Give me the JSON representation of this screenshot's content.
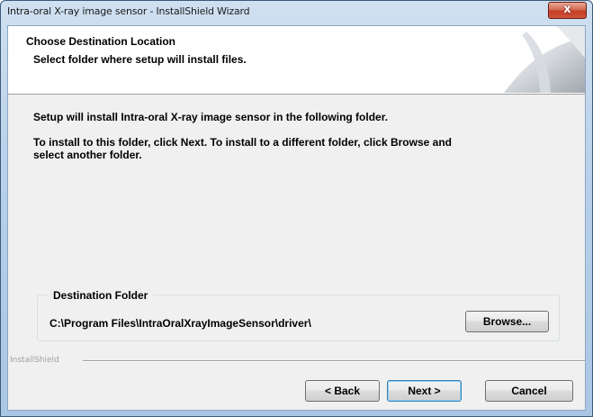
{
  "window": {
    "title": "Intra-oral X-ray image sensor - InstallShield Wizard",
    "close_glyph": "x"
  },
  "header": {
    "title": "Choose Destination Location",
    "subtitle": "Select folder where setup will install files."
  },
  "body": {
    "line1": "Setup will install Intra-oral X-ray image sensor in the following folder.",
    "line2a": "To install to this folder, click Next. To install to a different folder, click Browse and",
    "line2b": "select another folder."
  },
  "destination": {
    "group_label": "Destination Folder",
    "path": "C:\\Program Files\\IntraOralXrayImageSensor\\driver\\",
    "browse_label": "Browse..."
  },
  "footer": {
    "brand": "InstallShield",
    "back_label": "< Back",
    "next_label": "Next >",
    "cancel_label": "Cancel"
  }
}
